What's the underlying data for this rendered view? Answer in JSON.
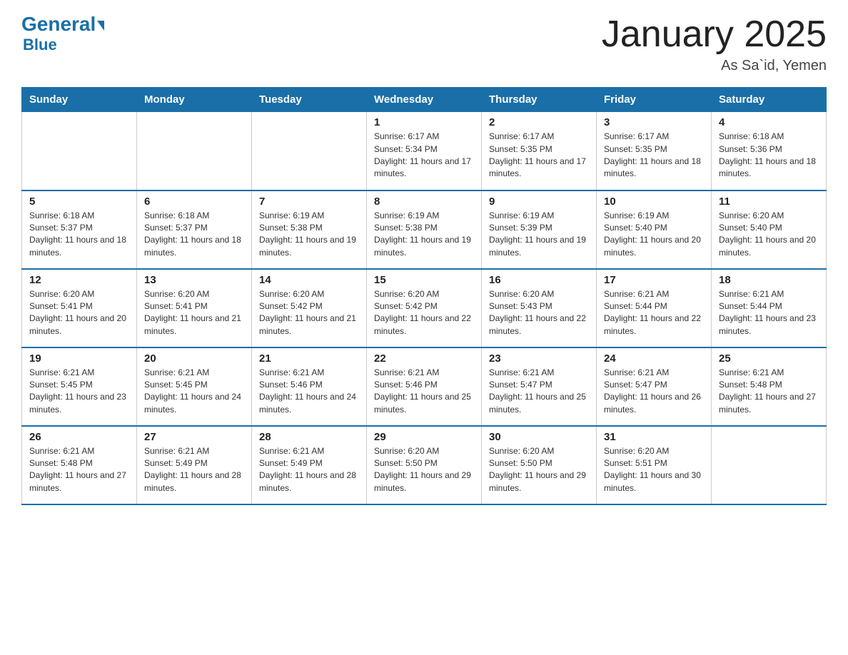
{
  "header": {
    "logo_general": "General",
    "logo_blue": "Blue",
    "title": "January 2025",
    "subtitle": "As Sa`id, Yemen"
  },
  "days_of_week": [
    "Sunday",
    "Monday",
    "Tuesday",
    "Wednesday",
    "Thursday",
    "Friday",
    "Saturday"
  ],
  "weeks": [
    [
      {
        "day": "",
        "info": ""
      },
      {
        "day": "",
        "info": ""
      },
      {
        "day": "",
        "info": ""
      },
      {
        "day": "1",
        "info": "Sunrise: 6:17 AM\nSunset: 5:34 PM\nDaylight: 11 hours and 17 minutes."
      },
      {
        "day": "2",
        "info": "Sunrise: 6:17 AM\nSunset: 5:35 PM\nDaylight: 11 hours and 17 minutes."
      },
      {
        "day": "3",
        "info": "Sunrise: 6:17 AM\nSunset: 5:35 PM\nDaylight: 11 hours and 18 minutes."
      },
      {
        "day": "4",
        "info": "Sunrise: 6:18 AM\nSunset: 5:36 PM\nDaylight: 11 hours and 18 minutes."
      }
    ],
    [
      {
        "day": "5",
        "info": "Sunrise: 6:18 AM\nSunset: 5:37 PM\nDaylight: 11 hours and 18 minutes."
      },
      {
        "day": "6",
        "info": "Sunrise: 6:18 AM\nSunset: 5:37 PM\nDaylight: 11 hours and 18 minutes."
      },
      {
        "day": "7",
        "info": "Sunrise: 6:19 AM\nSunset: 5:38 PM\nDaylight: 11 hours and 19 minutes."
      },
      {
        "day": "8",
        "info": "Sunrise: 6:19 AM\nSunset: 5:38 PM\nDaylight: 11 hours and 19 minutes."
      },
      {
        "day": "9",
        "info": "Sunrise: 6:19 AM\nSunset: 5:39 PM\nDaylight: 11 hours and 19 minutes."
      },
      {
        "day": "10",
        "info": "Sunrise: 6:19 AM\nSunset: 5:40 PM\nDaylight: 11 hours and 20 minutes."
      },
      {
        "day": "11",
        "info": "Sunrise: 6:20 AM\nSunset: 5:40 PM\nDaylight: 11 hours and 20 minutes."
      }
    ],
    [
      {
        "day": "12",
        "info": "Sunrise: 6:20 AM\nSunset: 5:41 PM\nDaylight: 11 hours and 20 minutes."
      },
      {
        "day": "13",
        "info": "Sunrise: 6:20 AM\nSunset: 5:41 PM\nDaylight: 11 hours and 21 minutes."
      },
      {
        "day": "14",
        "info": "Sunrise: 6:20 AM\nSunset: 5:42 PM\nDaylight: 11 hours and 21 minutes."
      },
      {
        "day": "15",
        "info": "Sunrise: 6:20 AM\nSunset: 5:42 PM\nDaylight: 11 hours and 22 minutes."
      },
      {
        "day": "16",
        "info": "Sunrise: 6:20 AM\nSunset: 5:43 PM\nDaylight: 11 hours and 22 minutes."
      },
      {
        "day": "17",
        "info": "Sunrise: 6:21 AM\nSunset: 5:44 PM\nDaylight: 11 hours and 22 minutes."
      },
      {
        "day": "18",
        "info": "Sunrise: 6:21 AM\nSunset: 5:44 PM\nDaylight: 11 hours and 23 minutes."
      }
    ],
    [
      {
        "day": "19",
        "info": "Sunrise: 6:21 AM\nSunset: 5:45 PM\nDaylight: 11 hours and 23 minutes."
      },
      {
        "day": "20",
        "info": "Sunrise: 6:21 AM\nSunset: 5:45 PM\nDaylight: 11 hours and 24 minutes."
      },
      {
        "day": "21",
        "info": "Sunrise: 6:21 AM\nSunset: 5:46 PM\nDaylight: 11 hours and 24 minutes."
      },
      {
        "day": "22",
        "info": "Sunrise: 6:21 AM\nSunset: 5:46 PM\nDaylight: 11 hours and 25 minutes."
      },
      {
        "day": "23",
        "info": "Sunrise: 6:21 AM\nSunset: 5:47 PM\nDaylight: 11 hours and 25 minutes."
      },
      {
        "day": "24",
        "info": "Sunrise: 6:21 AM\nSunset: 5:47 PM\nDaylight: 11 hours and 26 minutes."
      },
      {
        "day": "25",
        "info": "Sunrise: 6:21 AM\nSunset: 5:48 PM\nDaylight: 11 hours and 27 minutes."
      }
    ],
    [
      {
        "day": "26",
        "info": "Sunrise: 6:21 AM\nSunset: 5:48 PM\nDaylight: 11 hours and 27 minutes."
      },
      {
        "day": "27",
        "info": "Sunrise: 6:21 AM\nSunset: 5:49 PM\nDaylight: 11 hours and 28 minutes."
      },
      {
        "day": "28",
        "info": "Sunrise: 6:21 AM\nSunset: 5:49 PM\nDaylight: 11 hours and 28 minutes."
      },
      {
        "day": "29",
        "info": "Sunrise: 6:20 AM\nSunset: 5:50 PM\nDaylight: 11 hours and 29 minutes."
      },
      {
        "day": "30",
        "info": "Sunrise: 6:20 AM\nSunset: 5:50 PM\nDaylight: 11 hours and 29 minutes."
      },
      {
        "day": "31",
        "info": "Sunrise: 6:20 AM\nSunset: 5:51 PM\nDaylight: 11 hours and 30 minutes."
      },
      {
        "day": "",
        "info": ""
      }
    ]
  ]
}
